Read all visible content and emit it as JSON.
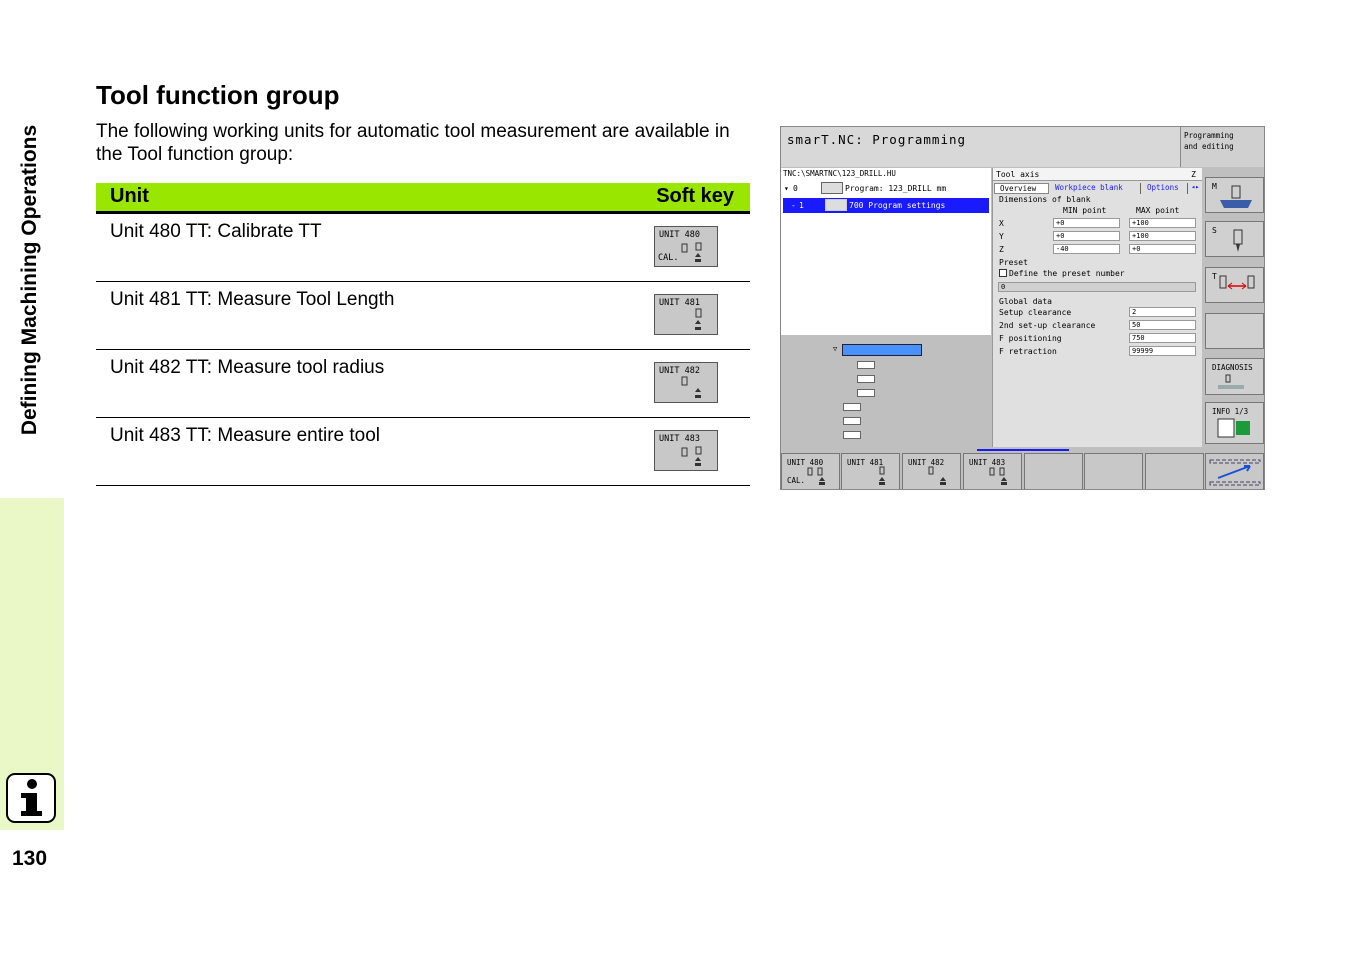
{
  "sidebar": {
    "vertical_title": "Defining Machining Operations",
    "page_number": "130",
    "info_icon": "i"
  },
  "heading": "Tool function group",
  "intro": "The following working units for automatic tool measurement are available in the Tool function group:",
  "table": {
    "headers": {
      "unit": "Unit",
      "softkey": "Soft key"
    },
    "rows": [
      {
        "label": "Unit 480 TT: Calibrate TT",
        "key_top": "UNIT 480",
        "key_bottom": "CAL."
      },
      {
        "label": "Unit 481 TT: Measure Tool Length",
        "key_top": "UNIT 481",
        "key_bottom": ""
      },
      {
        "label": "Unit 482 TT: Measure tool radius",
        "key_top": "UNIT 482",
        "key_bottom": ""
      },
      {
        "label": "Unit 483 TT: Measure entire tool",
        "key_top": "UNIT 483",
        "key_bottom": ""
      }
    ]
  },
  "screen": {
    "title": "smarT.NC: Programming",
    "mode": [
      "Programming",
      "and editing"
    ],
    "path": "TNC:\\SMARTNC\\123_DRILL.HU",
    "tree": [
      {
        "index": "0",
        "label": "Program: 123_DRILL mm"
      },
      {
        "index": "1",
        "label": "700 Program settings"
      }
    ],
    "form": {
      "header_left": "Tool axis",
      "header_right": "Z",
      "tabs": [
        "Overview",
        "Workpiece blank",
        "Options"
      ],
      "blank_title": "Dimensions of blank",
      "min_label": "MIN point",
      "max_label": "MAX point",
      "axes": [
        {
          "axis": "X",
          "min": "+0",
          "max": "+100"
        },
        {
          "axis": "Y",
          "min": "+0",
          "max": "+100"
        },
        {
          "axis": "Z",
          "min": "-40",
          "max": "+0"
        }
      ],
      "preset_title": "Preset",
      "preset_check": "Define the preset number",
      "preset_value": "0",
      "global_title": "Global data",
      "globals": [
        {
          "label": "Setup clearance",
          "value": "2"
        },
        {
          "label": "2nd set-up clearance",
          "value": "50"
        },
        {
          "label": "F positioning",
          "value": "750"
        },
        {
          "label": "F retraction",
          "value": "99999"
        }
      ]
    },
    "right_buttons": [
      "M",
      "S",
      "T",
      "",
      "DIAGNOSIS",
      "INFO 1/3"
    ],
    "softkeys": [
      {
        "top": "UNIT 480",
        "bottom": "CAL."
      },
      {
        "top": "UNIT 481",
        "bottom": ""
      },
      {
        "top": "UNIT 482",
        "bottom": ""
      },
      {
        "top": "UNIT 483",
        "bottom": ""
      }
    ]
  },
  "colors": {
    "header_green": "#99e600",
    "sidebar_green": "#eaf8c8",
    "selection_blue": "#1a1aff"
  }
}
